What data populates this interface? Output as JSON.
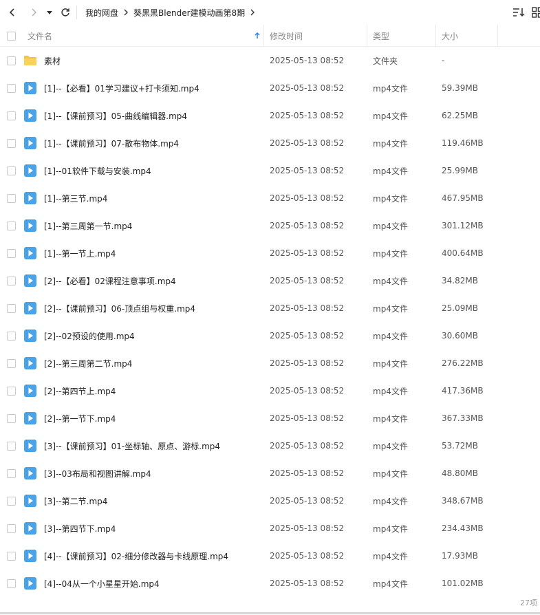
{
  "toolbar": {
    "breadcrumb": [
      "我的网盘",
      "葵黑黑Blender建模动画第8期"
    ],
    "icons": {
      "back": "chevron-left-icon",
      "forward": "chevron-right-icon",
      "history": "caret-down-icon",
      "refresh": "refresh-icon",
      "sort": "sort-icon",
      "view": "grid-view-icon"
    }
  },
  "columns": {
    "name": "文件名",
    "time": "修改时间",
    "type": "类型",
    "size": "大小"
  },
  "sort": {
    "column": "name",
    "direction": "asc"
  },
  "colors": {
    "folder": "#f6c343",
    "video": "#4aa3e8",
    "accent": "#2d86f0"
  },
  "files": [
    {
      "name": "素材",
      "time": "2025-05-13 08:52",
      "type": "文件夹",
      "size": "-",
      "kind": "folder"
    },
    {
      "name": "[1]--【必看】01学习建议+打卡须知.mp4",
      "time": "2025-05-13 08:52",
      "type": "mp4文件",
      "size": "59.39MB",
      "kind": "video"
    },
    {
      "name": "[1]--【课前预习】05-曲线编辑器.mp4",
      "time": "2025-05-13 08:52",
      "type": "mp4文件",
      "size": "62.25MB",
      "kind": "video"
    },
    {
      "name": "[1]--【课前预习】07-散布物体.mp4",
      "time": "2025-05-13 08:52",
      "type": "mp4文件",
      "size": "119.46MB",
      "kind": "video"
    },
    {
      "name": "[1]--01软件下载与安装.mp4",
      "time": "2025-05-13 08:52",
      "type": "mp4文件",
      "size": "25.99MB",
      "kind": "video"
    },
    {
      "name": "[1]--第三节.mp4",
      "time": "2025-05-13 08:52",
      "type": "mp4文件",
      "size": "467.95MB",
      "kind": "video"
    },
    {
      "name": "[1]--第三周第一节.mp4",
      "time": "2025-05-13 08:52",
      "type": "mp4文件",
      "size": "301.12MB",
      "kind": "video"
    },
    {
      "name": "[1]--第一节上.mp4",
      "time": "2025-05-13 08:52",
      "type": "mp4文件",
      "size": "400.64MB",
      "kind": "video"
    },
    {
      "name": "[2]--【必看】02课程注意事项.mp4",
      "time": "2025-05-13 08:52",
      "type": "mp4文件",
      "size": "34.82MB",
      "kind": "video"
    },
    {
      "name": "[2]--【课前预习】06-顶点组与权重.mp4",
      "time": "2025-05-13 08:52",
      "type": "mp4文件",
      "size": "25.09MB",
      "kind": "video"
    },
    {
      "name": "[2]--02预设的使用.mp4",
      "time": "2025-05-13 08:52",
      "type": "mp4文件",
      "size": "30.60MB",
      "kind": "video"
    },
    {
      "name": "[2]--第三周第二节.mp4",
      "time": "2025-05-13 08:52",
      "type": "mp4文件",
      "size": "276.22MB",
      "kind": "video"
    },
    {
      "name": "[2]--第四节上.mp4",
      "time": "2025-05-13 08:52",
      "type": "mp4文件",
      "size": "417.36MB",
      "kind": "video"
    },
    {
      "name": "[2]--第一节下.mp4",
      "time": "2025-05-13 08:52",
      "type": "mp4文件",
      "size": "367.33MB",
      "kind": "video"
    },
    {
      "name": "[3]--【课前预习】01-坐标轴、原点、游标.mp4",
      "time": "2025-05-13 08:52",
      "type": "mp4文件",
      "size": "53.72MB",
      "kind": "video"
    },
    {
      "name": "[3]--03布局和视图讲解.mp4",
      "time": "2025-05-13 08:52",
      "type": "mp4文件",
      "size": "48.80MB",
      "kind": "video"
    },
    {
      "name": "[3]--第二节.mp4",
      "time": "2025-05-13 08:52",
      "type": "mp4文件",
      "size": "348.67MB",
      "kind": "video"
    },
    {
      "name": "[3]--第四节下.mp4",
      "time": "2025-05-13 08:52",
      "type": "mp4文件",
      "size": "234.43MB",
      "kind": "video"
    },
    {
      "name": "[4]--【课前预习】02-细分修改器与卡线原理.mp4",
      "time": "2025-05-13 08:52",
      "type": "mp4文件",
      "size": "17.93MB",
      "kind": "video"
    },
    {
      "name": "[4]--04从一个小星星开始.mp4",
      "time": "2025-05-13 08:52",
      "type": "mp4文件",
      "size": "101.02MB",
      "kind": "video"
    }
  ],
  "footer": {
    "count": "27项"
  }
}
